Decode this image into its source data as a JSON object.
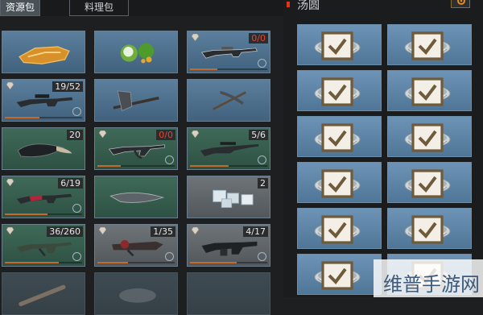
{
  "tabs": [
    {
      "label": "资源包",
      "active": true
    },
    {
      "label": "料理包",
      "active": false
    }
  ],
  "right_panel": {
    "title": "汤圆"
  },
  "slots": [
    {
      "kind": "honey",
      "bg": "blue",
      "count": "",
      "durability": null
    },
    {
      "kind": "coconut",
      "bg": "blue",
      "count": "",
      "durability": null
    },
    {
      "kind": "rifle",
      "bg": "blue",
      "count": "0/0",
      "count_red": true,
      "durability": 0.35
    },
    {
      "kind": "rifle-scope",
      "bg": "blue",
      "count": "19/52",
      "count_red": false,
      "durability": 0.45
    },
    {
      "kind": "axe",
      "bg": "blue",
      "count": "",
      "durability": null
    },
    {
      "kind": "pickaxe",
      "bg": "blue",
      "count": "",
      "durability": null
    },
    {
      "kind": "beak",
      "bg": "green",
      "count": "20",
      "count_red": false,
      "durability": null
    },
    {
      "kind": "ak",
      "bg": "green",
      "count": "0/0",
      "count_red": true,
      "durability": 0.3
    },
    {
      "kind": "sniper",
      "bg": "green",
      "count": "5/6",
      "count_red": false,
      "durability": 0.5
    },
    {
      "kind": "red-rifle",
      "bg": "green",
      "count": "6/19",
      "count_red": false,
      "durability": 0.55
    },
    {
      "kind": "machete",
      "bg": "green",
      "count": "",
      "durability": null
    },
    {
      "kind": "ice",
      "bg": "gray",
      "count": "2",
      "count_red": false,
      "durability": null
    },
    {
      "kind": "camo-rifle",
      "bg": "green",
      "count": "36/260",
      "count_red": false,
      "durability": 0.7
    },
    {
      "kind": "launcher",
      "bg": "gray",
      "count": "1/35",
      "count_red": false,
      "durability": 0.4
    },
    {
      "kind": "heavy-gun",
      "bg": "gray",
      "count": "4/17",
      "count_red": false,
      "durability": 0.6
    },
    {
      "kind": "bat",
      "bg": "dim",
      "count": "",
      "durability": null
    },
    {
      "kind": "bowl",
      "bg": "dim",
      "count": "",
      "durability": null
    },
    {
      "kind": "empty",
      "bg": "dim",
      "count": "",
      "durability": null
    }
  ],
  "soups": [
    {
      "balls": [
        "#d9b7c4",
        "#f4f1ea",
        "#6a3b3b"
      ],
      "tags": 2
    },
    {
      "balls": [
        "#d9b7c4",
        "#f4f1ea",
        "#6a3b3b"
      ],
      "tags": 2
    },
    {
      "balls": [
        "#f2c9d6",
        "#e8e2d6",
        "#b6d3a6"
      ],
      "tags": 2
    },
    {
      "balls": [
        "#f2c9d6",
        "#e8e2d6",
        "#b6d3a6"
      ],
      "tags": 1
    },
    {
      "balls": [
        "#9bc36a",
        "#e8c34a",
        "#e85f8a"
      ],
      "tags": 1
    },
    {
      "balls": [
        "#9bc36a",
        "#e8c34a",
        "#e85f8a"
      ],
      "tags": 1
    },
    {
      "balls": [
        "#9bc36a",
        "#e8c34a",
        "#c48fd6"
      ],
      "tags": 1
    },
    {
      "balls": [
        "#9bc36a",
        "#e8c34a",
        "#c48fd6"
      ],
      "tags": 1
    },
    {
      "balls": [
        "#9bc36a",
        "#e8c34a",
        "#c48fd6"
      ],
      "tags": 1
    },
    {
      "balls": [
        "#9bc36a",
        "#e8c34a",
        "#c48fd6"
      ],
      "tags": 1
    },
    {
      "balls": [
        "#c9a3d6",
        "#f0e6d0",
        "#8fb8d6"
      ],
      "tags": 1
    },
    {
      "balls": [
        "#c9a3d6",
        "#f0e6d0",
        "#8fb8d6"
      ],
      "tags": 1
    }
  ],
  "watermark": "维普手游网"
}
